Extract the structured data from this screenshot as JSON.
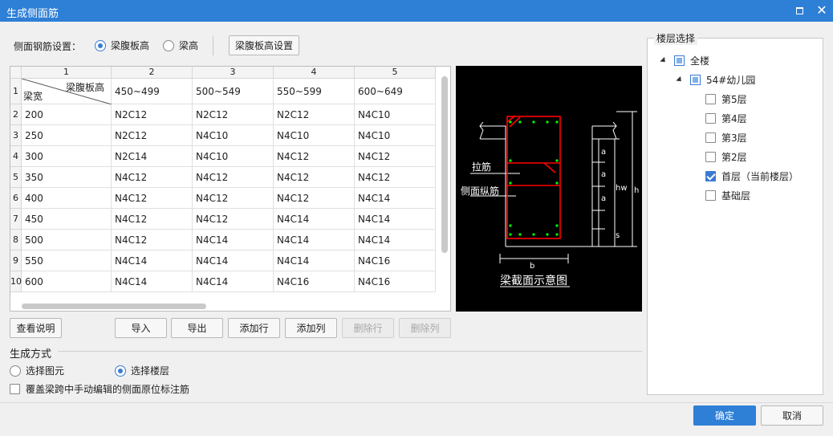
{
  "window": {
    "title": "生成侧面筋"
  },
  "settings": {
    "label": "侧面钢筋设置：",
    "radio_web_height": "梁腹板高",
    "radio_beam_height": "梁高",
    "web_height_button": "梁腹板高设置",
    "selected": "梁腹板高"
  },
  "grid": {
    "col_numbers": [
      "1",
      "2",
      "3",
      "4",
      "5"
    ],
    "header_top": "梁腹板高",
    "header_bottom": "梁宽",
    "columns": [
      "450~499",
      "500~549",
      "550~599",
      "600~649"
    ],
    "rows": [
      {
        "n": "2",
        "width": "200",
        "values": [
          "N2C12",
          "N2C12",
          "N2C12",
          "N4C10"
        ]
      },
      {
        "n": "3",
        "width": "250",
        "values": [
          "N2C12",
          "N4C10",
          "N4C10",
          "N4C10"
        ]
      },
      {
        "n": "4",
        "width": "300",
        "values": [
          "N2C14",
          "N4C10",
          "N4C12",
          "N4C12"
        ]
      },
      {
        "n": "5",
        "width": "350",
        "values": [
          "N4C12",
          "N4C12",
          "N4C12",
          "N4C12"
        ]
      },
      {
        "n": "6",
        "width": "400",
        "values": [
          "N4C12",
          "N4C12",
          "N4C12",
          "N4C14"
        ]
      },
      {
        "n": "7",
        "width": "450",
        "values": [
          "N4C12",
          "N4C12",
          "N4C14",
          "N4C14"
        ]
      },
      {
        "n": "8",
        "width": "500",
        "values": [
          "N4C12",
          "N4C14",
          "N4C14",
          "N4C14"
        ]
      },
      {
        "n": "9",
        "width": "550",
        "values": [
          "N4C14",
          "N4C14",
          "N4C14",
          "N4C16"
        ]
      },
      {
        "n": "10",
        "width": "600",
        "values": [
          "N4C14",
          "N4C14",
          "N4C16",
          "N4C16"
        ]
      }
    ],
    "row1": "1"
  },
  "diagram": {
    "label_tie": "拉筋",
    "label_side": "侧面纵筋",
    "dim_a": "a",
    "dim_s": "s",
    "dim_hw": "hw",
    "dim_h": "h",
    "dim_b": "b",
    "caption": "梁截面示意图",
    "colors": {
      "stirrup": "#ff0000",
      "bar": "#00ff00",
      "line": "#ffffff"
    }
  },
  "actions": {
    "help": "查看说明",
    "import": "导入",
    "export": "导出",
    "add_row": "添加行",
    "add_col": "添加列",
    "del_row": "删除行",
    "del_col": "删除列"
  },
  "generation": {
    "label": "生成方式",
    "opt_element": "选择图元",
    "opt_floor": "选择楼层",
    "selected": "选择楼层",
    "overwrite": "覆盖梁跨中手动编辑的侧面原位标注筋"
  },
  "floors": {
    "title": "楼层选择",
    "all": "全楼",
    "project": "54#幼儿园",
    "items": [
      {
        "label": "第5层",
        "checked": false
      },
      {
        "label": "第4层",
        "checked": false
      },
      {
        "label": "第3层",
        "checked": false
      },
      {
        "label": "第2层",
        "checked": false
      },
      {
        "label": "首层（当前楼层）",
        "checked": true
      },
      {
        "label": "基础层",
        "checked": false
      }
    ]
  },
  "footer": {
    "ok": "确定",
    "cancel": "取消"
  },
  "theme": {
    "accent": "#2e7fd6"
  }
}
